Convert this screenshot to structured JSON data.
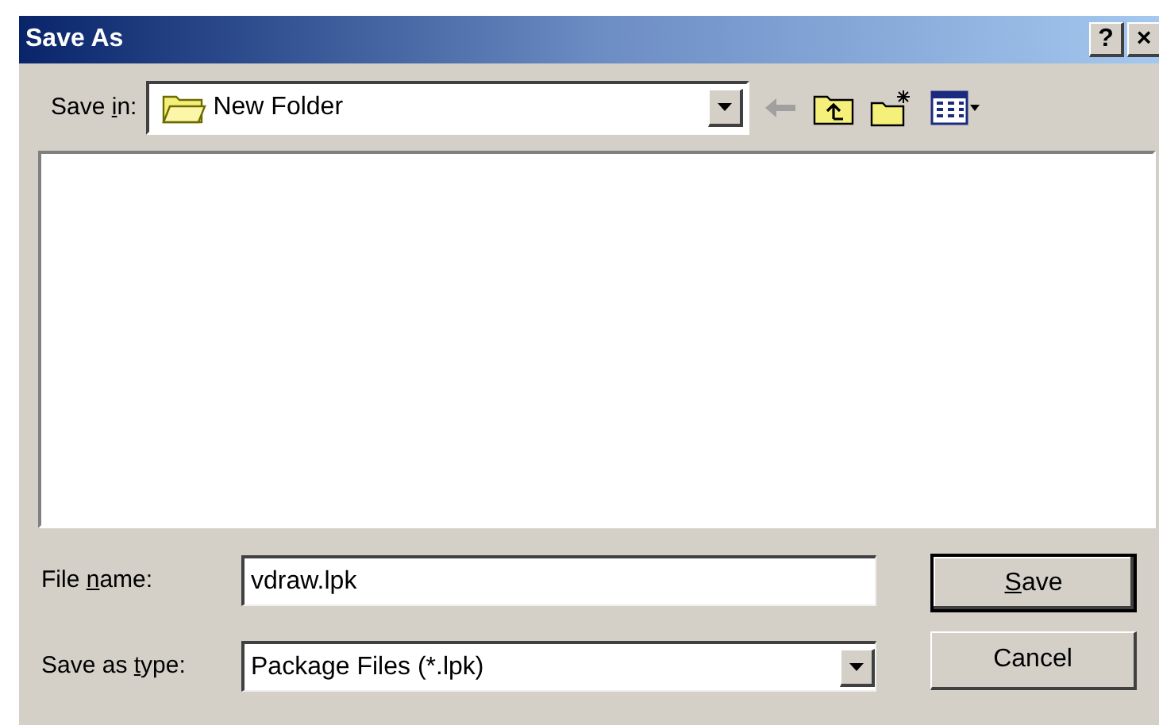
{
  "window": {
    "title": "Save As",
    "buttons": [
      "?",
      "×"
    ]
  },
  "save_in": {
    "label": {
      "before": "Save ",
      "key": "i",
      "after": "n:"
    },
    "value": "New Folder"
  },
  "toolbar": [
    {
      "kind": "back",
      "disabled": true
    },
    {
      "kind": "up"
    },
    {
      "kind": "new_folder"
    },
    {
      "kind": "view_menu"
    }
  ],
  "file_name": {
    "label": {
      "before": "File ",
      "key": "n",
      "after": "ame:"
    },
    "value": "vdraw.lpk"
  },
  "save_as_type": {
    "label": {
      "before": "Save as ",
      "key": "t",
      "after": "ype:"
    },
    "value": "Package Files (*.lpk)"
  },
  "buttons": [
    {
      "label": {
        "key": "S",
        "after": "ave"
      },
      "default": true
    },
    {
      "label": {
        "before": "Cancel"
      },
      "default": false
    }
  ]
}
